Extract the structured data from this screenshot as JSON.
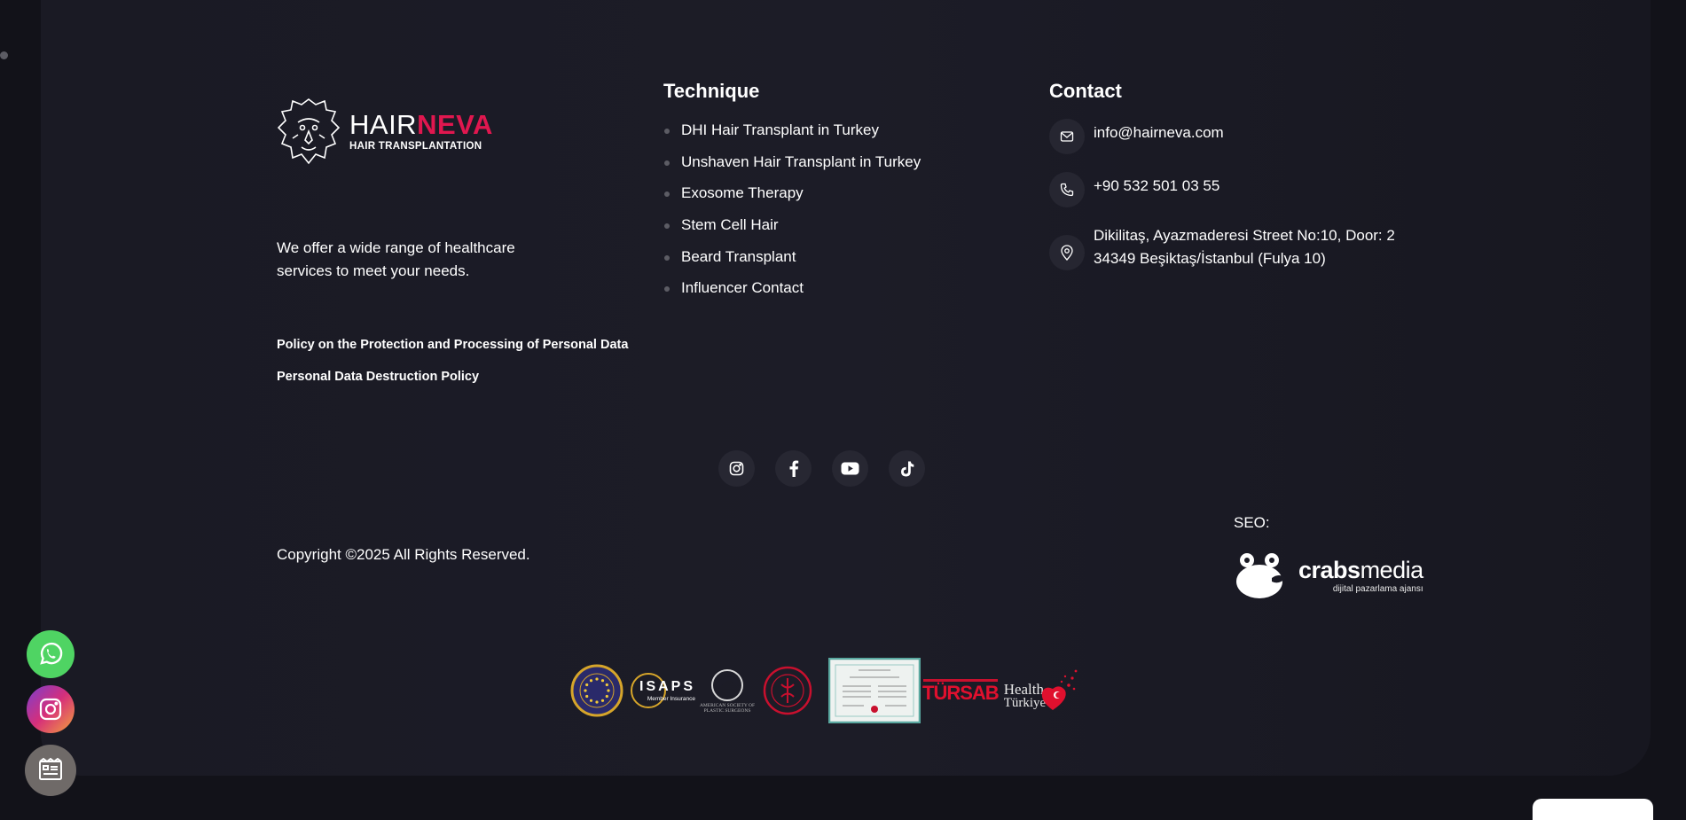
{
  "brand": {
    "name_part1": "HAIR",
    "name_part2": "NEVA",
    "subtitle": "HAIR TRANSPLANTATION",
    "tagline": "We offer a wide range of healthcare services to meet your needs.",
    "accent_color": "#e0174f"
  },
  "policies": [
    "Policy on the Protection and Processing of Personal Data",
    "Personal Data Destruction Policy"
  ],
  "technique": {
    "title": "Technique",
    "items": [
      "DHI Hair Transplant in Turkey",
      "Unshaven Hair Transplant in Turkey",
      "Exosome Therapy",
      "Stem Cell Hair",
      "Beard Transplant",
      "Influencer Contact"
    ]
  },
  "contact": {
    "title": "Contact",
    "email": "info@hairneva.com",
    "phone": "+90 532 501 03 55",
    "address_line1": "Dikilitaş, Ayazmaderesi Street No:10, Door: 2",
    "address_line2": "34349 Beşiktaş/İstanbul (Fulya 10)"
  },
  "socials": [
    "instagram-icon",
    "facebook-icon",
    "youtube-icon",
    "tiktok-icon"
  ],
  "footer": {
    "copyright": "Copyright ©2025 All Rights Reserved.",
    "seo_label": "SEO:",
    "agency_name_bold": "crabs",
    "agency_name_rest": "media",
    "agency_tagline": "dijital pazarlama ajansı"
  },
  "certifications": {
    "isaps_title": "ISAPS",
    "isaps_sub": "Member Insurance",
    "asps_line1": "AMERICAN SOCIETY OF",
    "asps_line2": "PLASTIC SURGEONS",
    "tursab": "TÜRSAB",
    "health_line1": "Health",
    "health_line2": "Türkiye"
  },
  "floating": [
    "whatsapp-icon",
    "instagram-icon",
    "newsletter-icon"
  ]
}
